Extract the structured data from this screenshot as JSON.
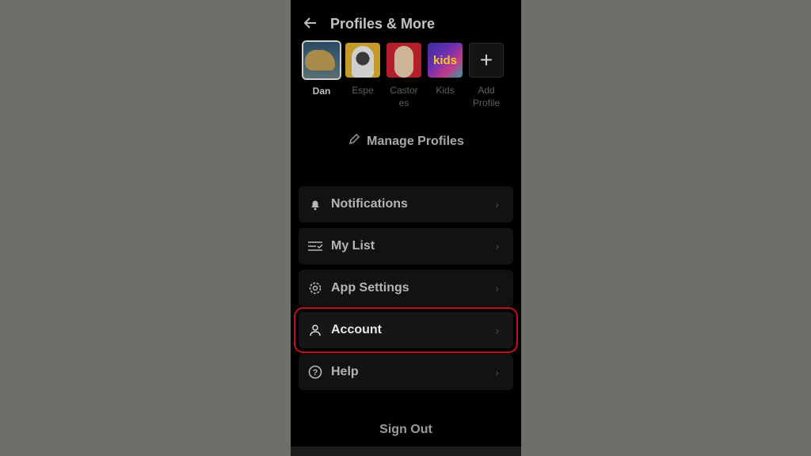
{
  "header": {
    "title": "Profiles & More",
    "back_icon": "arrow-left"
  },
  "profiles": [
    {
      "name": "Dan",
      "selected": true
    },
    {
      "name": "Espe",
      "selected": false
    },
    {
      "name": "Castor es",
      "selected": false
    },
    {
      "name": "Kids",
      "selected": false,
      "badge": "kids"
    },
    {
      "name": "Add Profile",
      "selected": false
    }
  ],
  "profile_labels": {
    "dan": "Dan",
    "espe": "Espe",
    "castores_1": "Castor",
    "castores_2": "es",
    "kids": "Kids",
    "kids_badge": "kids",
    "add_1": "Add",
    "add_2": "Profile",
    "add_symbol": "+"
  },
  "manage_profiles": {
    "label": "Manage Profiles",
    "icon": "pencil"
  },
  "menu": [
    {
      "label": "Notifications",
      "icon": "bell"
    },
    {
      "label": "My List",
      "icon": "list-check"
    },
    {
      "label": "App Settings",
      "icon": "gear"
    },
    {
      "label": "Account",
      "icon": "user",
      "highlighted": true
    },
    {
      "label": "Help",
      "icon": "question-circle"
    }
  ],
  "chevron": "›",
  "sign_out": "Sign Out",
  "colors": {
    "highlight": "#c1121c",
    "background": "#000000",
    "outer": "#6f6e6b"
  }
}
